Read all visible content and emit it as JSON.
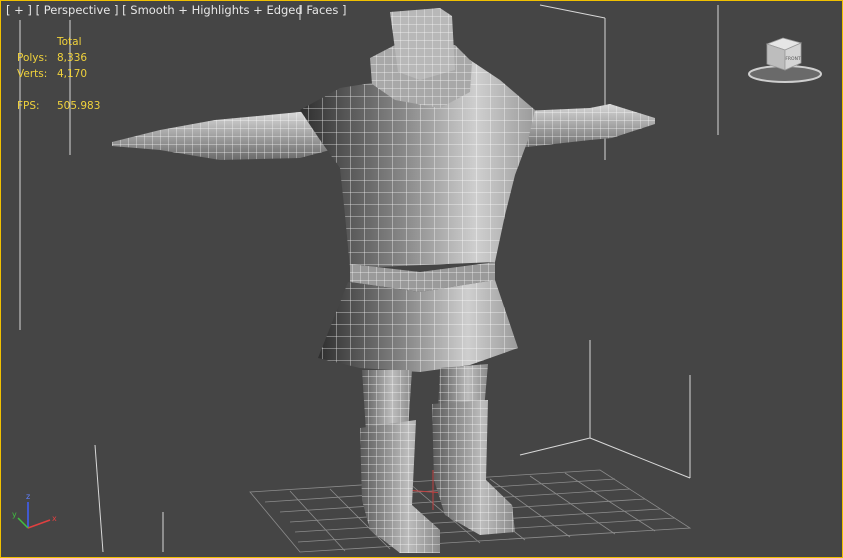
{
  "viewport": {
    "label_plus": "[ + ]",
    "label_view": "[ Perspective ]",
    "label_shading": "[ Smooth + Highlights + Edged Faces ]"
  },
  "stats": {
    "header": "Total",
    "polys_label": "Polys:",
    "polys_value": "8,336",
    "verts_label": "Verts:",
    "verts_value": "4,170",
    "fps_label": "FPS:",
    "fps_value": "505.983"
  },
  "viewcube": {
    "face_top": "TOP",
    "face_front": "FRONT",
    "face_left": "LEFT",
    "icon": "viewcube-icon"
  },
  "axis": {
    "x": "x",
    "y": "y",
    "z": "z"
  },
  "colors": {
    "background": "#454545",
    "active_border": "#f0c000",
    "stats_text": "#f0d23c",
    "wireframe": "#ffffff",
    "grid": "#8c8c8c"
  }
}
